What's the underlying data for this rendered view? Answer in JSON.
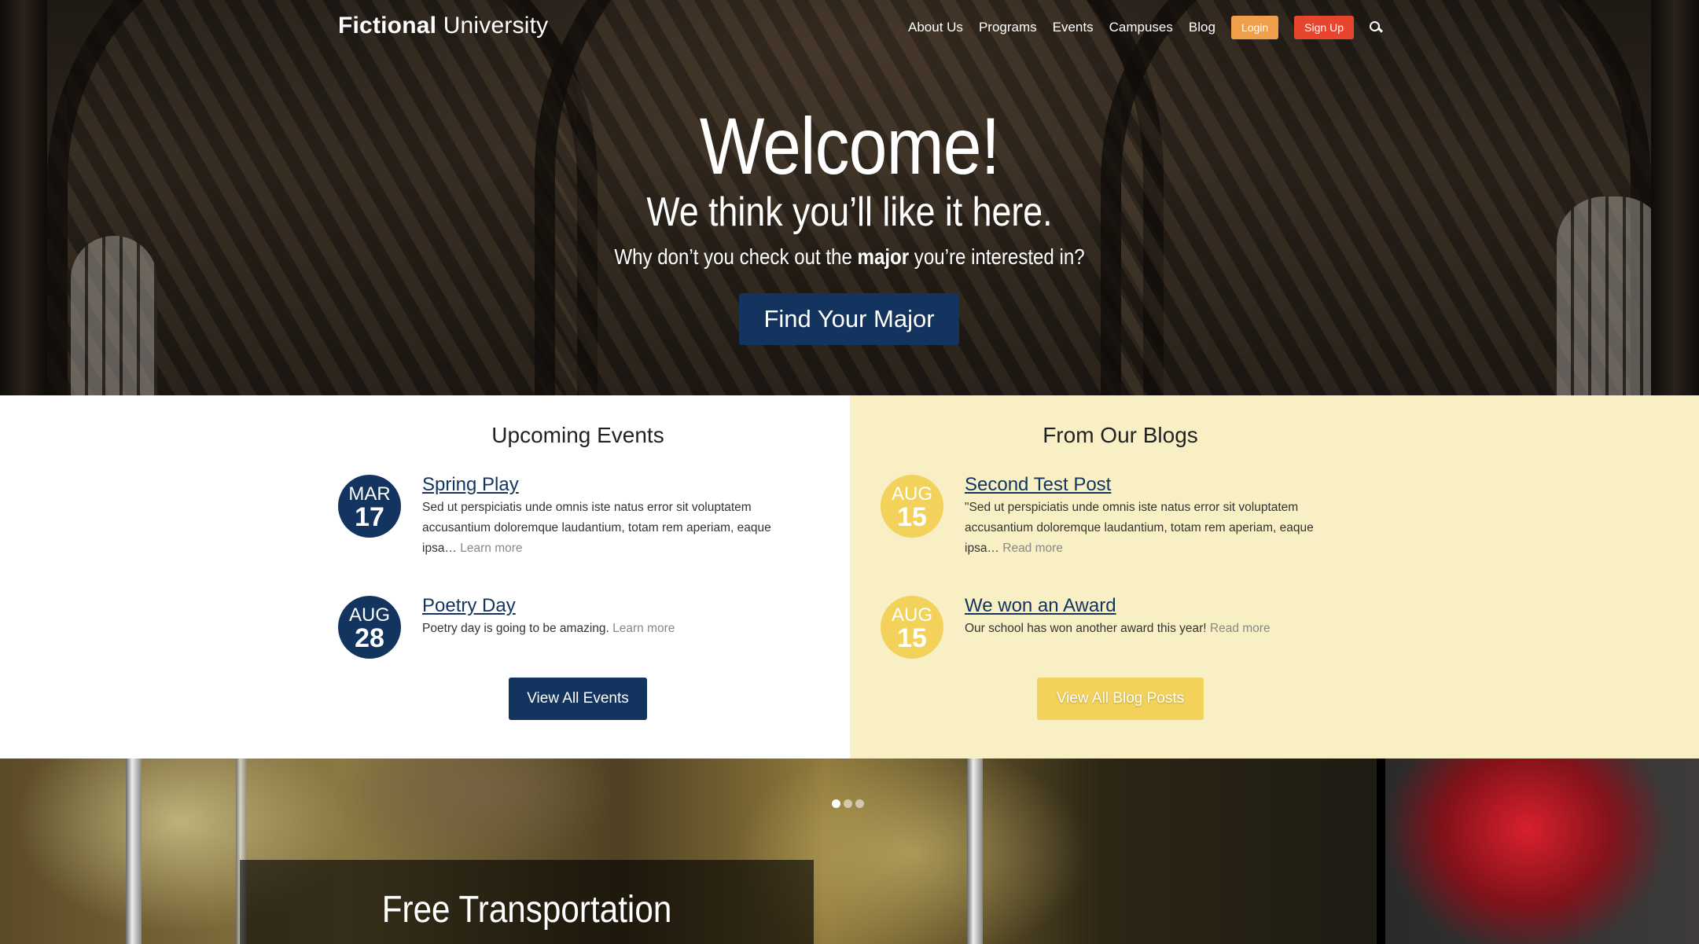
{
  "header": {
    "logo_bold": "Fictional",
    "logo_light": "University",
    "nav": [
      "About Us",
      "Programs",
      "Events",
      "Campuses",
      "Blog"
    ],
    "login_label": "Login",
    "signup_label": "Sign Up",
    "search_icon": "search-icon"
  },
  "hero": {
    "title": "Welcome!",
    "subtitle": "We think you’ll like it here.",
    "prompt_before": "Why don’t you check out the ",
    "prompt_bold": "major",
    "prompt_after": " you’re interested in?",
    "button_label": "Find Your Major"
  },
  "events": {
    "heading": "Upcoming Events",
    "items": [
      {
        "month": "MAR",
        "day": "17",
        "title": "Spring Play",
        "excerpt": "Sed ut perspiciatis unde omnis iste natus error sit voluptatem accusantium doloremque laudantium, totam rem aperiam, eaque ipsa…",
        "link": "Learn more"
      },
      {
        "month": "AUG",
        "day": "28",
        "title": "Poetry Day",
        "excerpt": "Poetry day is going to be amazing.",
        "link": "Learn more"
      }
    ],
    "view_all_label": "View All Events"
  },
  "blogs": {
    "heading": "From Our Blogs",
    "items": [
      {
        "month": "AUG",
        "day": "15",
        "title": "Second Test Post",
        "excerpt": "\"Sed ut perspiciatis unde omnis iste natus error sit voluptatem accusantium doloremque laudantium, totam rem aperiam, eaque ipsa…",
        "link": "Read more"
      },
      {
        "month": "AUG",
        "day": "15",
        "title": "We won an Award",
        "excerpt": "Our school has won another award this year!",
        "link": "Read more"
      }
    ],
    "view_all_label": "View All Blog Posts"
  },
  "slider": {
    "caption_title": "Free Transportation",
    "dot_count": 3,
    "active_dot": 0
  },
  "colors": {
    "navy": "#12345e",
    "yellow": "#f2d25a",
    "cream": "#f8efc5",
    "login_orange": "#f0a04b",
    "signup_red": "#e8452f"
  }
}
